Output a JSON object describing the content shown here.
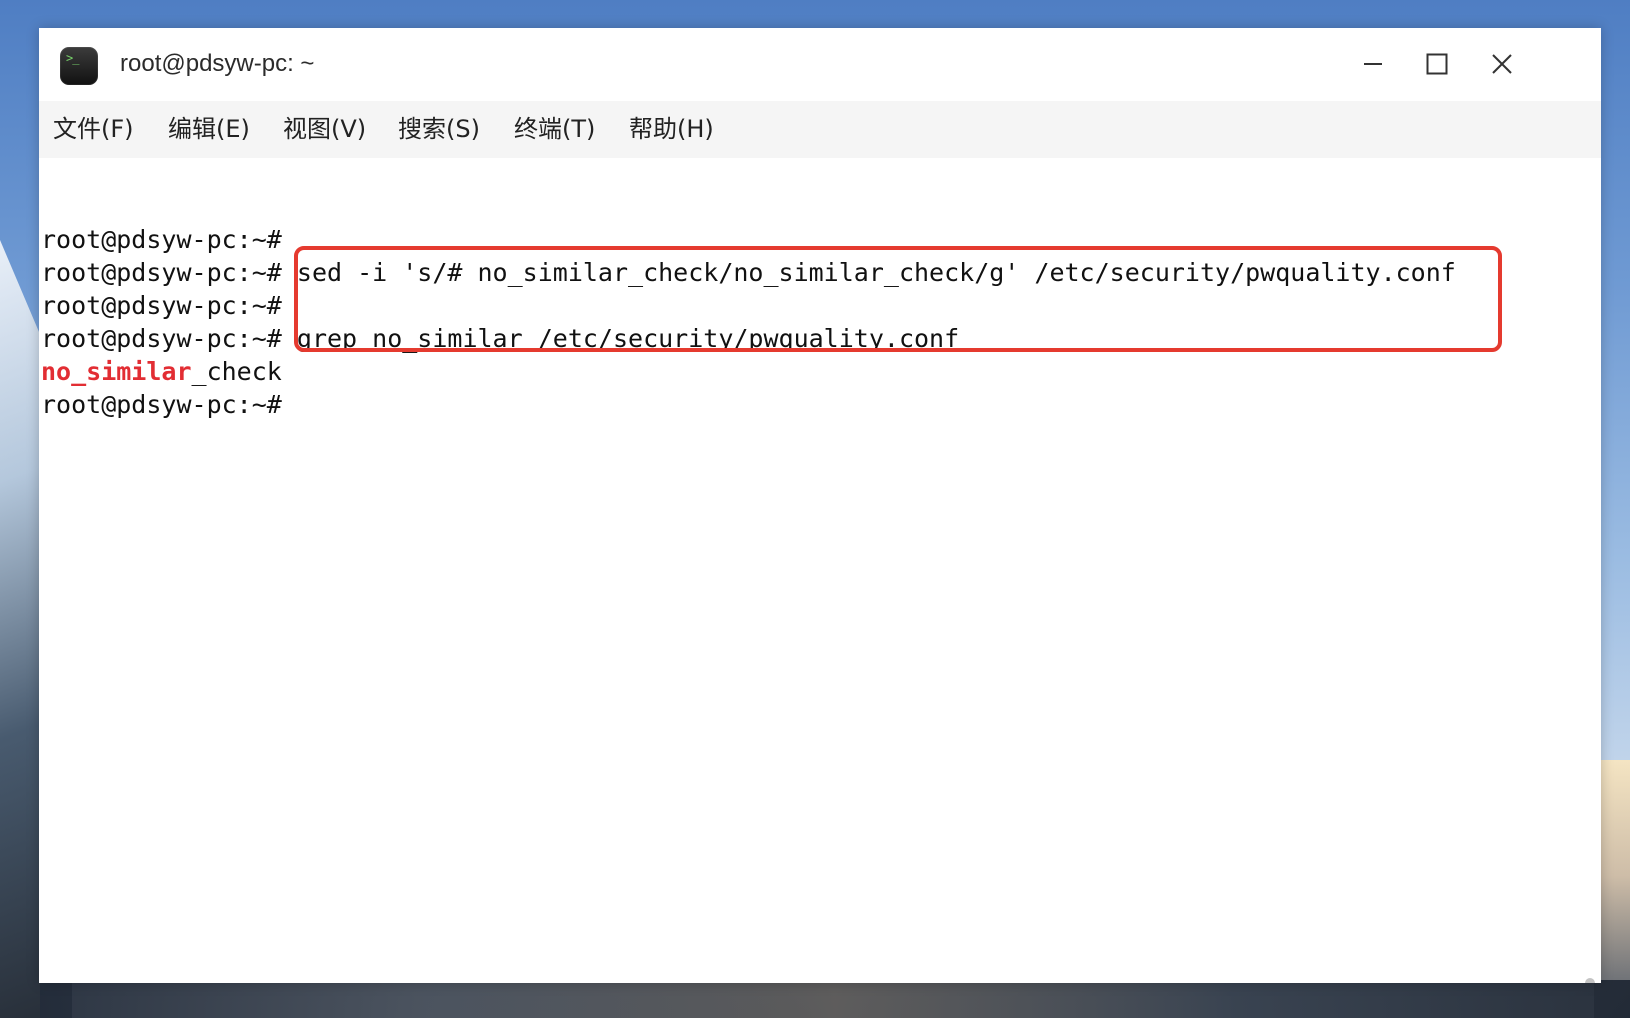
{
  "window": {
    "title": "root@pdsyw-pc: ~",
    "controls": {
      "minimize_icon": "minimize-icon",
      "maximize_icon": "maximize-icon",
      "close_icon": "close-icon"
    },
    "app_icon": {
      "name": "terminal-app-icon",
      "glyph": ">_"
    }
  },
  "menu": {
    "items": [
      "文件(F)",
      "编辑(E)",
      "视图(V)",
      "搜索(S)",
      "终端(T)",
      "帮助(H)"
    ]
  },
  "terminal": {
    "prompt": "root@pdsyw-pc:~#",
    "lines": [
      {
        "prompt": "root@pdsyw-pc:~#",
        "command": ""
      },
      {
        "prompt": "root@pdsyw-pc:~#",
        "command": "sed -i 's/# no_similar_check/no_similar_check/g' /etc/security/pwquality.conf"
      },
      {
        "prompt": "root@pdsyw-pc:~#",
        "command": ""
      },
      {
        "prompt": "root@pdsyw-pc:~#",
        "command": "grep no_similar /etc/security/pwquality.conf"
      },
      {
        "output_match": "no_similar",
        "output_rest": "_check"
      },
      {
        "prompt": "root@pdsyw-pc:~#",
        "command": ""
      }
    ]
  },
  "colors": {
    "highlight_box": "#e53a2f",
    "match_text": "#e22d33",
    "menu_background": "#f5f5f5",
    "terminal_background": "#ffffff"
  }
}
